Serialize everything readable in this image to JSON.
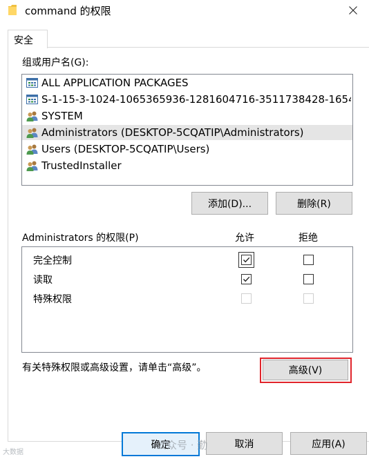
{
  "window": {
    "title": "command 的权限"
  },
  "tabs": [
    {
      "label": "安全"
    }
  ],
  "groups": {
    "label": "组或用户名(G):",
    "items": [
      {
        "name": "ALL APPLICATION PACKAGES",
        "icon": "app-packages-icon"
      },
      {
        "name": "S-1-15-3-1024-1065365936-1281604716-3511738428-1654…",
        "icon": "app-packages-icon"
      },
      {
        "name": "SYSTEM",
        "icon": "users-group-icon"
      },
      {
        "name": "Administrators (DESKTOP-5CQATIP\\Administrators)",
        "icon": "users-group-icon",
        "selected": true
      },
      {
        "name": "Users (DESKTOP-5CQATIP\\Users)",
        "icon": "users-group-icon"
      },
      {
        "name": "TrustedInstaller",
        "icon": "users-group-icon"
      }
    ]
  },
  "buttons": {
    "add": "添加(D)...",
    "remove": "删除(R)",
    "advanced": "高级(V)",
    "ok": "确定",
    "cancel": "取消",
    "apply": "应用(A)"
  },
  "permissions": {
    "label": "Administrators 的权限(P)",
    "allow_header": "允许",
    "deny_header": "拒绝",
    "rows": [
      {
        "name": "完全控制",
        "allow": true,
        "deny": false,
        "enabled": true
      },
      {
        "name": "读取",
        "allow": true,
        "deny": false,
        "enabled": true
      },
      {
        "name": "特殊权限",
        "allow": false,
        "deny": false,
        "enabled": false
      }
    ]
  },
  "advanced_text": "有关特殊权限或高级设置，请单击“高级”。",
  "watermark": {
    "text": "公众号 · 勤",
    "logo_text": "大数据"
  },
  "colors": {
    "highlight": "#e0242b",
    "selected_row": "#e5e5e5",
    "ok_border": "#0078d7"
  }
}
